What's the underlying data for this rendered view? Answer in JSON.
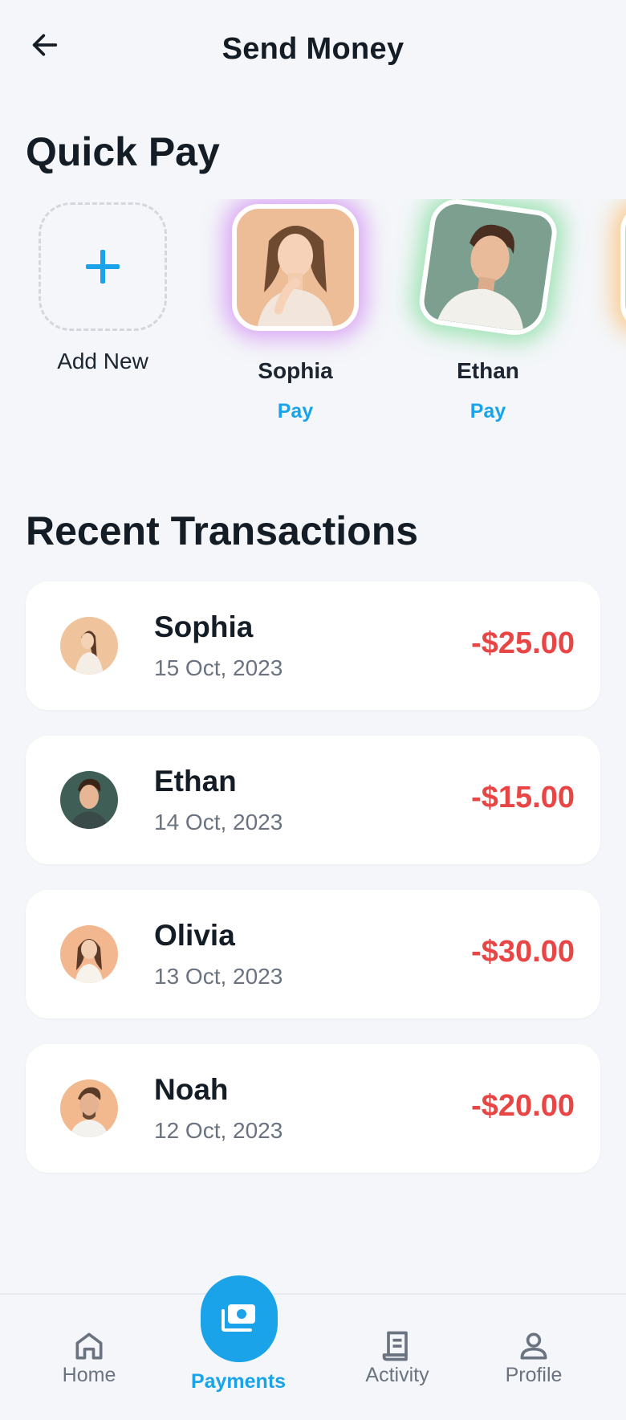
{
  "header": {
    "title": "Send Money",
    "back_icon": "arrow-left-icon"
  },
  "quick_pay": {
    "title": "Quick Pay",
    "add_new": {
      "label": "Add New",
      "icon": "plus-icon"
    },
    "contacts": [
      {
        "name": "Sophia",
        "action": "Pay",
        "glow": "#c76af0"
      },
      {
        "name": "Ethan",
        "action": "Pay",
        "glow": "#5cd680"
      }
    ],
    "partial_contact_glow": "#ffac40"
  },
  "recent_transactions": {
    "title": "Recent Transactions",
    "items": [
      {
        "name": "Sophia",
        "date": "15 Oct, 2023",
        "amount": "-$25.00"
      },
      {
        "name": "Ethan",
        "date": "14 Oct, 2023",
        "amount": "-$15.00"
      },
      {
        "name": "Olivia",
        "date": "13 Oct, 2023",
        "amount": "-$30.00"
      },
      {
        "name": "Noah",
        "date": "12 Oct, 2023",
        "amount": "-$20.00"
      }
    ]
  },
  "nav": {
    "items": [
      {
        "label": "Home",
        "icon": "home-icon"
      },
      {
        "label": "Payments",
        "icon": "payments-icon",
        "active": true
      },
      {
        "label": "Activity",
        "icon": "receipt-icon"
      },
      {
        "label": "Profile",
        "icon": "user-icon"
      }
    ]
  },
  "colors": {
    "accent": "#1aa3e8",
    "negative_amount": "#e84545",
    "background": "#f4f6f9",
    "card": "#ffffff"
  }
}
